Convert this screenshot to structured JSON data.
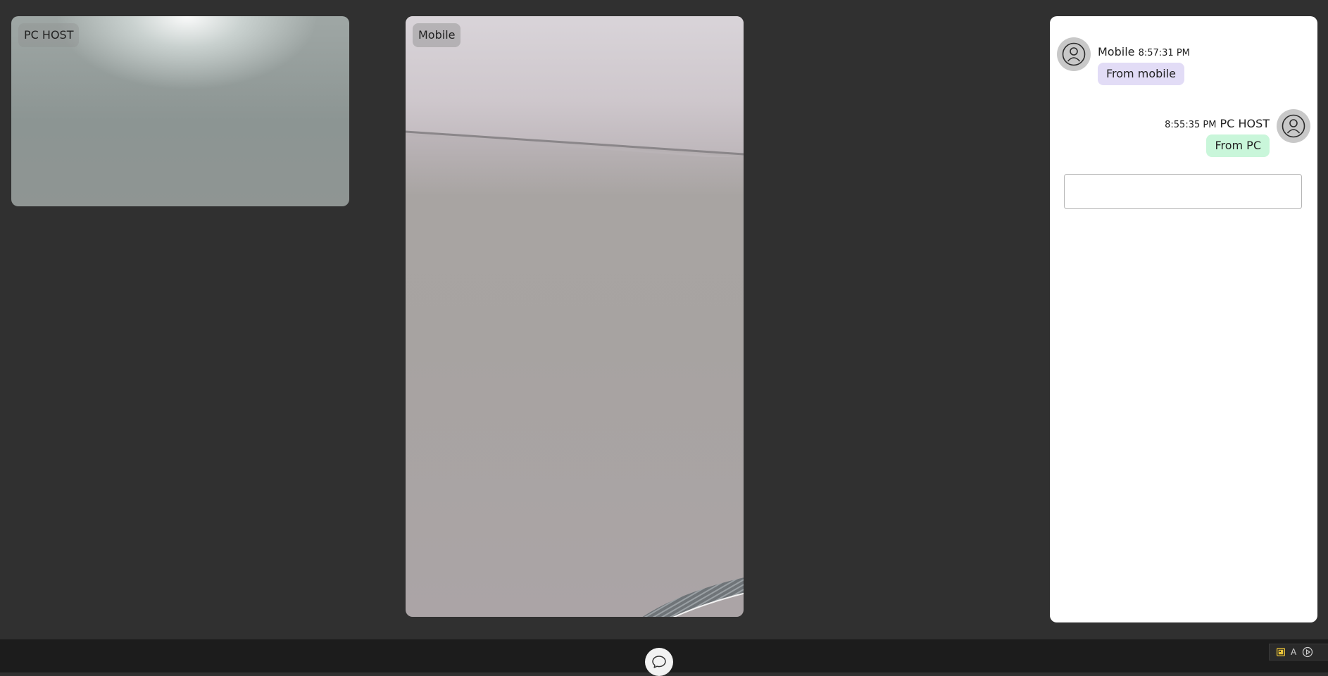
{
  "videos": {
    "local": {
      "label": "PC HOST"
    },
    "remote": {
      "label": "Mobile"
    }
  },
  "chat": {
    "messages": [
      {
        "sender": "Mobile",
        "time": "8:57:31 PM",
        "text": "From mobile",
        "side": "left"
      },
      {
        "sender": "PC HOST",
        "time": "8:55:35 PM",
        "text": "From PC",
        "side": "right"
      }
    ],
    "input": {
      "value": "",
      "placeholder": ""
    }
  },
  "toolbar": {
    "chat_toggle_icon": "chat-bubble-icon"
  },
  "tray": {
    "letter": "A",
    "icons": [
      "app-icon",
      "keyboard-letter-icon",
      "play-icon"
    ]
  },
  "colors": {
    "background": "#303030",
    "bottom_bar": "#1c1c1c",
    "their_bubble": "#e2dcf6",
    "my_bubble": "#c9f6da"
  }
}
